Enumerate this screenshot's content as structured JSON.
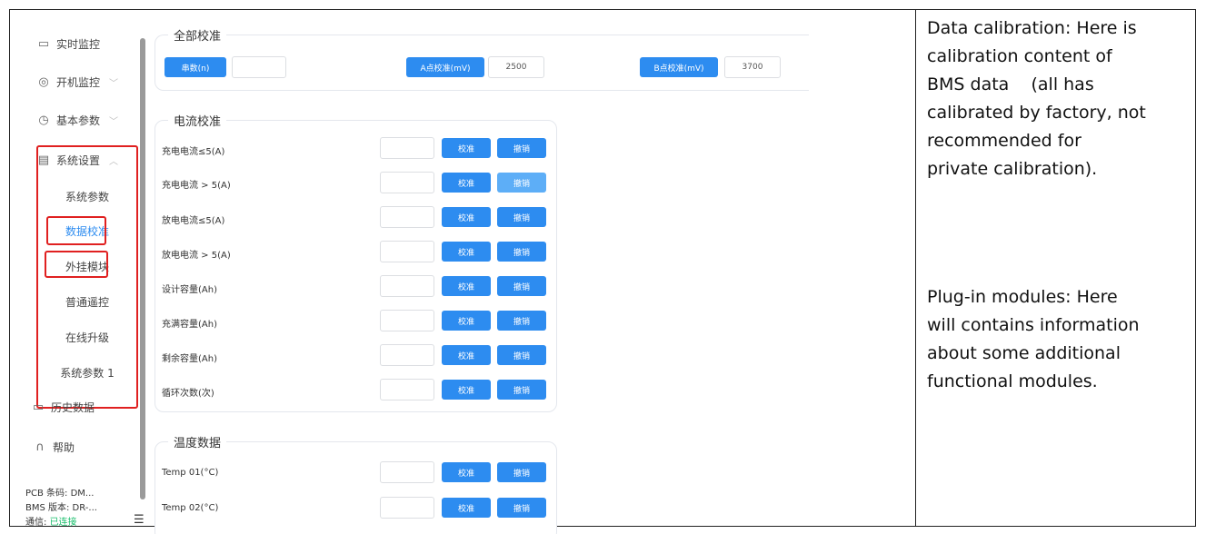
{
  "sidebar": {
    "items": [
      {
        "label": "实时监控",
        "icon": "monitor-icon"
      },
      {
        "label": "开机监控",
        "icon": "eye-icon"
      },
      {
        "label": "基本参数",
        "icon": "gauge-icon"
      },
      {
        "label": "系统设置",
        "icon": "settings-icon"
      }
    ],
    "sub_items": [
      "系统参数",
      "数据校准",
      "外挂模块",
      "普通遥控",
      "在线升级",
      "系统参数 1"
    ],
    "history": {
      "label": "历史数据",
      "icon": "folder-icon"
    },
    "help": {
      "label": "帮助",
      "icon": "headset-icon"
    },
    "footer": {
      "pcb": "PCB 条码: DM...",
      "bms": "BMS 版本: DR-...",
      "comm_label": "通信:",
      "comm_status": "已连接"
    },
    "menu_icon": "menu-icon"
  },
  "all_calibration": {
    "title": "全部校准",
    "fields": [
      {
        "button": "串数(n)",
        "value": ""
      },
      {
        "button": "A点校准(mV)",
        "value": "2500"
      },
      {
        "button": "B点校准(mV)",
        "value": "3700"
      }
    ]
  },
  "current_calibration": {
    "title": "电流校准",
    "calibrate_label": "校准",
    "cancel_label": "撤销",
    "rows": [
      "充电电流≤5(A)",
      "充电电流 > 5(A)",
      "放电电流≤5(A)",
      "放电电流 > 5(A)",
      "设计容量(Ah)",
      "充满容量(Ah)",
      "剩余容量(Ah)",
      "循环次数(次)"
    ]
  },
  "temperature_data": {
    "title": "温度数据",
    "rows": [
      "Temp 01(°C)",
      "Temp 02(°C)"
    ]
  },
  "description": {
    "para1": [
      "Data calibration: Here is",
      "calibration content of",
      "BMS data    (all has",
      "calibrated by factory, not",
      "recommended for",
      "private calibration)."
    ],
    "para2": [
      "Plug-in modules: Here",
      "will contains information",
      "about some additional",
      "functional modules."
    ]
  },
  "colors": {
    "accent": "#2d8cf0",
    "highlight": "#e02020",
    "connected": "#19be6b"
  }
}
